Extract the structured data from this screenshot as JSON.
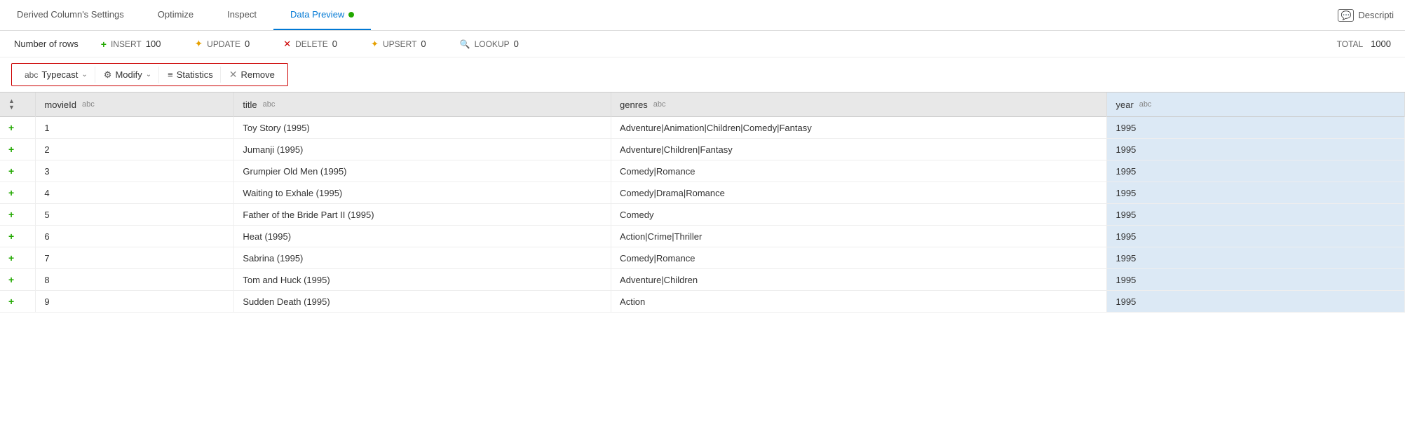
{
  "tabs": [
    {
      "id": "settings",
      "label": "Derived Column's Settings",
      "active": false
    },
    {
      "id": "optimize",
      "label": "Optimize",
      "active": false
    },
    {
      "id": "inspect",
      "label": "Inspect",
      "active": false
    },
    {
      "id": "data-preview",
      "label": "Data Preview",
      "active": true,
      "dot": true
    }
  ],
  "tab_right_label": "Descripti",
  "stats": {
    "row_label": "Number of rows",
    "insert_label": "INSERT",
    "insert_val": "100",
    "update_label": "UPDATE",
    "update_val": "0",
    "delete_label": "DELETE",
    "delete_val": "0",
    "upsert_label": "UPSERT",
    "upsert_val": "0",
    "lookup_label": "LOOKUP",
    "lookup_val": "0",
    "total_label": "TOTAL",
    "total_val": "1000"
  },
  "toolbar": {
    "typecast_label": "Typecast",
    "modify_label": "Modify",
    "statistics_label": "Statistics",
    "remove_label": "Remove"
  },
  "table": {
    "columns": [
      {
        "id": "expand",
        "label": "",
        "type": ""
      },
      {
        "id": "movieid",
        "label": "movieId",
        "type": "abc",
        "sortable": true
      },
      {
        "id": "title",
        "label": "title",
        "type": "abc",
        "sortable": true
      },
      {
        "id": "genres",
        "label": "genres",
        "type": "abc",
        "sortable": true
      },
      {
        "id": "year",
        "label": "year",
        "type": "abc",
        "sortable": true,
        "highlighted": true
      }
    ],
    "rows": [
      {
        "expand": "+",
        "movieid": "1",
        "title": "Toy Story (1995)",
        "genres": "Adventure|Animation|Children|Comedy|Fantasy",
        "year": "1995"
      },
      {
        "expand": "+",
        "movieid": "2",
        "title": "Jumanji (1995)",
        "genres": "Adventure|Children|Fantasy",
        "year": "1995"
      },
      {
        "expand": "+",
        "movieid": "3",
        "title": "Grumpier Old Men (1995)",
        "genres": "Comedy|Romance",
        "year": "1995"
      },
      {
        "expand": "+",
        "movieid": "4",
        "title": "Waiting to Exhale (1995)",
        "genres": "Comedy|Drama|Romance",
        "year": "1995"
      },
      {
        "expand": "+",
        "movieid": "5",
        "title": "Father of the Bride Part II (1995)",
        "genres": "Comedy",
        "year": "1995"
      },
      {
        "expand": "+",
        "movieid": "6",
        "title": "Heat (1995)",
        "genres": "Action|Crime|Thriller",
        "year": "1995"
      },
      {
        "expand": "+",
        "movieid": "7",
        "title": "Sabrina (1995)",
        "genres": "Comedy|Romance",
        "year": "1995"
      },
      {
        "expand": "+",
        "movieid": "8",
        "title": "Tom and Huck (1995)",
        "genres": "Adventure|Children",
        "year": "1995"
      },
      {
        "expand": "+",
        "movieid": "9",
        "title": "Sudden Death (1995)",
        "genres": "Action",
        "year": "1995"
      }
    ]
  }
}
